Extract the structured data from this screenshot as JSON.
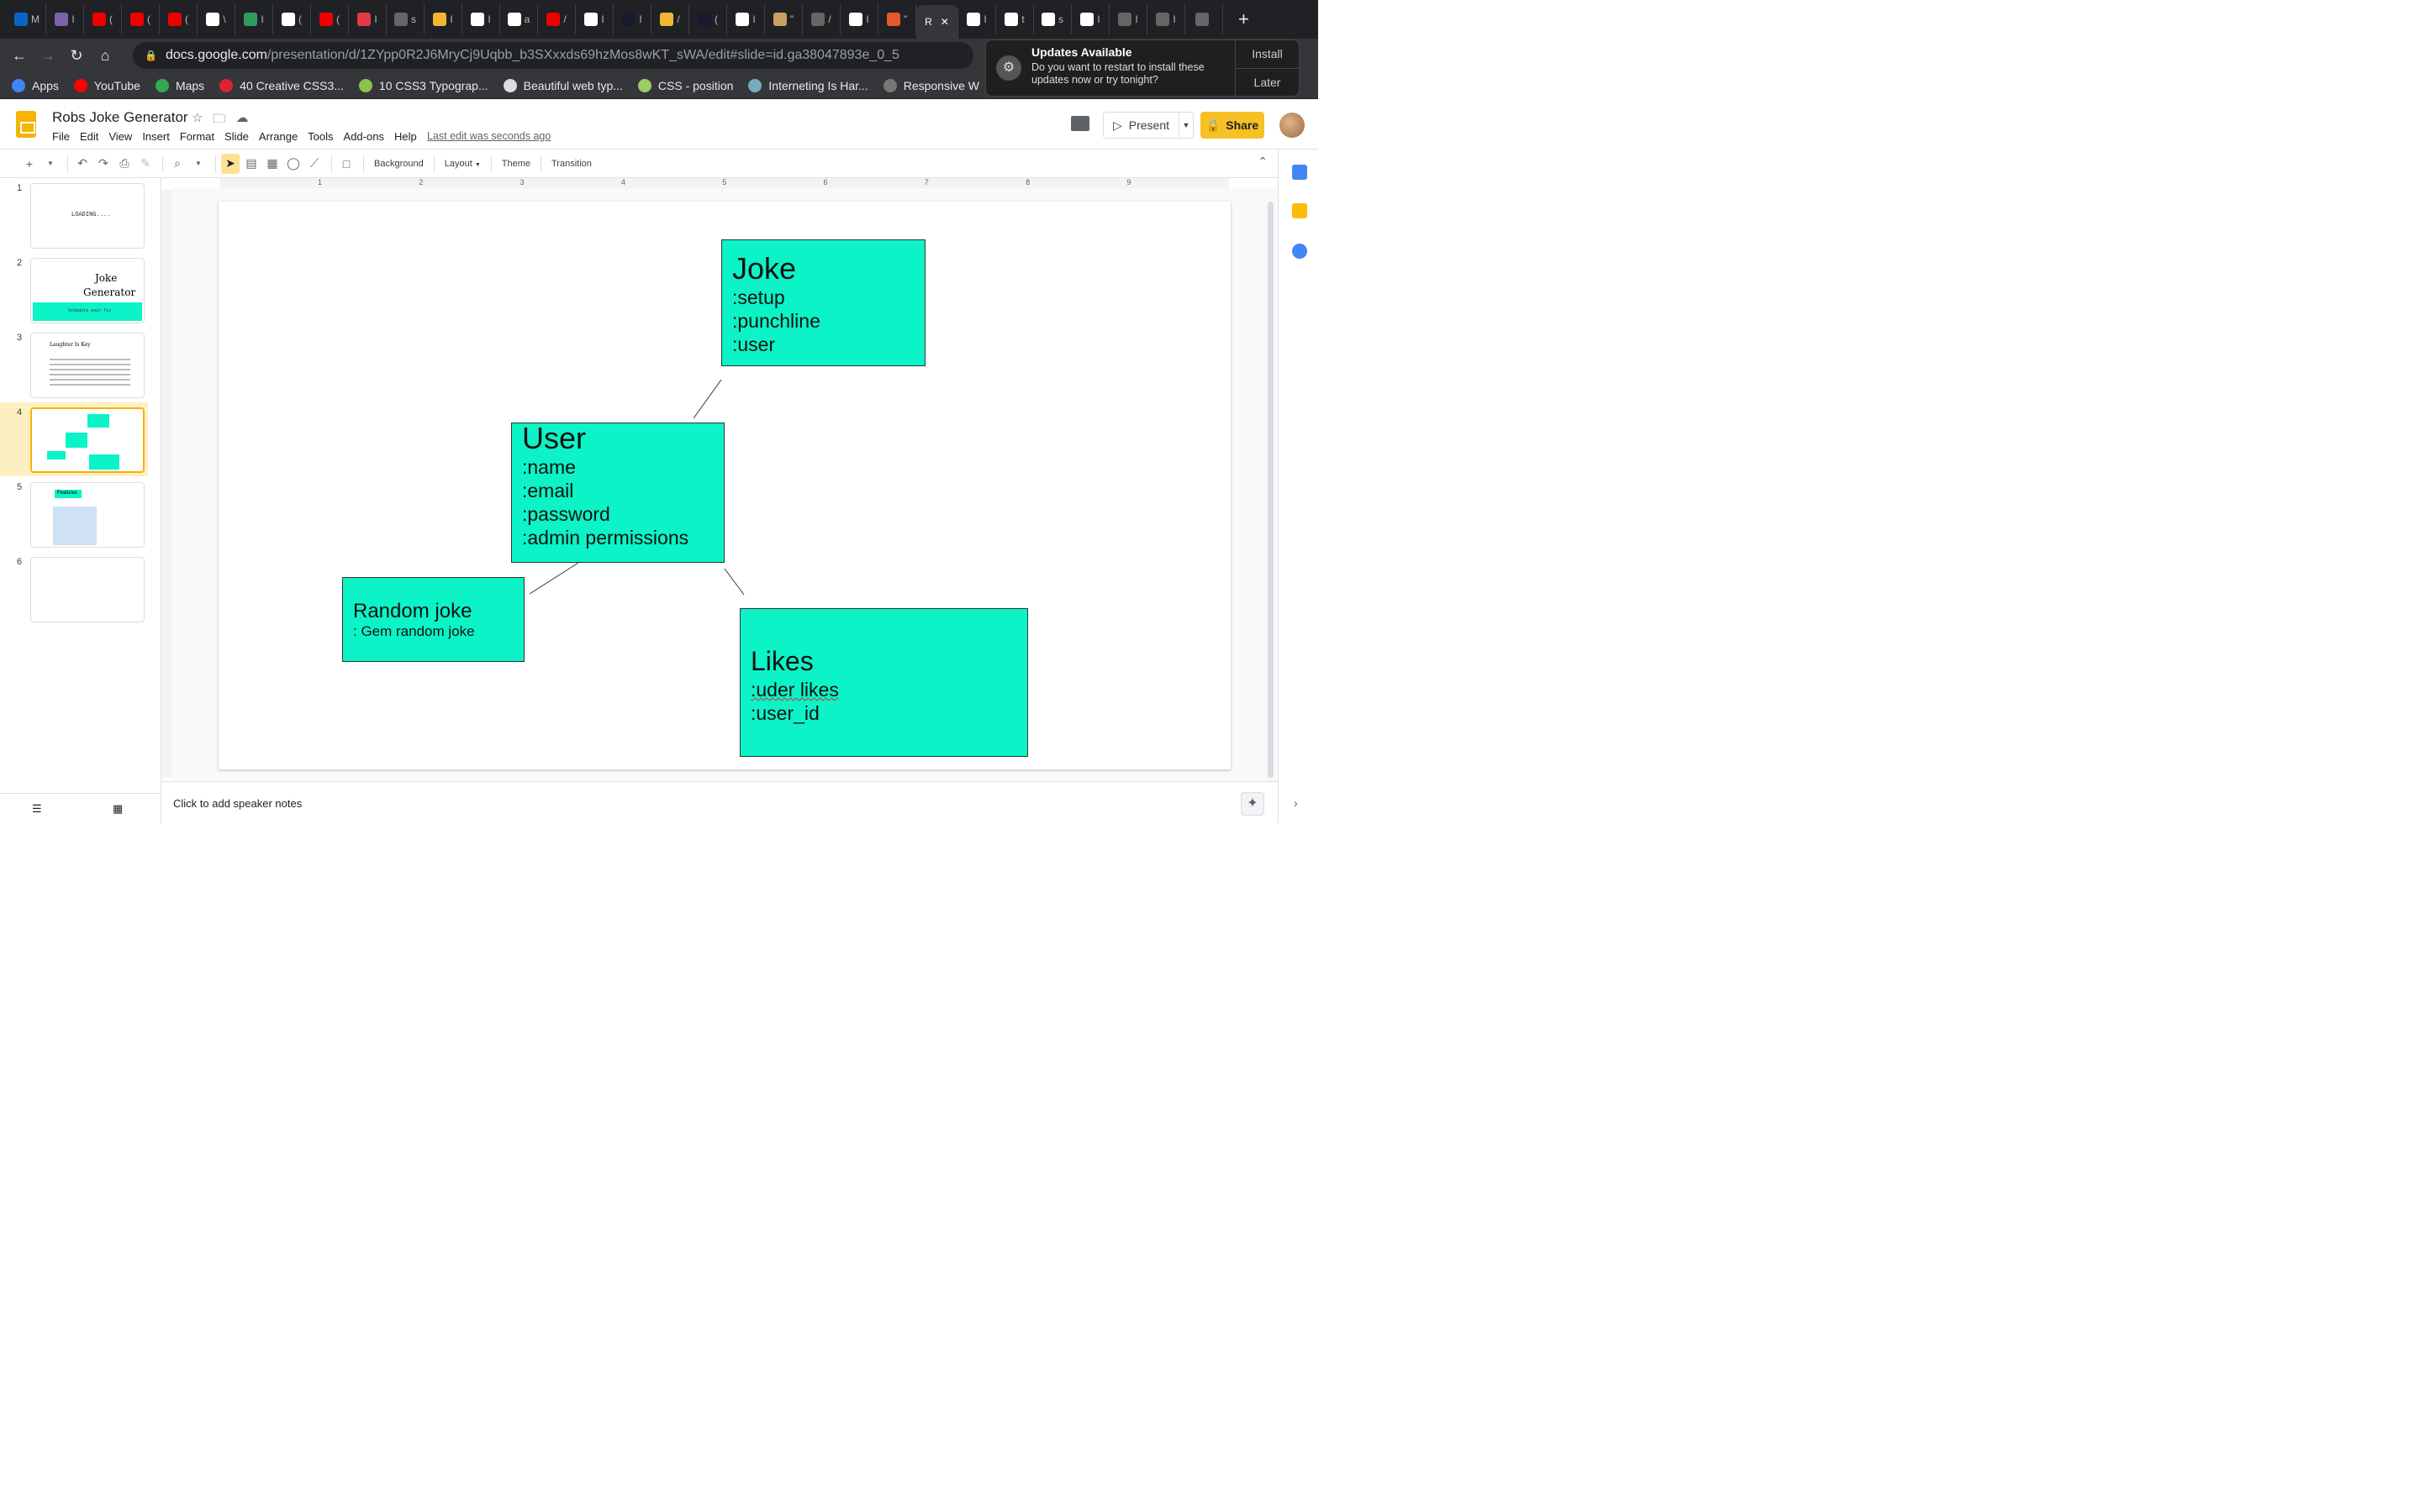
{
  "browser": {
    "tabs": [
      {
        "icon": "outlook-icon",
        "color": "#0a64c8",
        "label": "M"
      },
      {
        "icon": "heroku-icon",
        "color": "#7b61a8",
        "label": "I"
      },
      {
        "icon": "red-hat-icon",
        "color": "#e00",
        "label": "("
      },
      {
        "icon": "red-hat-icon",
        "color": "#e00",
        "label": "("
      },
      {
        "icon": "red-hat-icon",
        "color": "#e00",
        "label": "("
      },
      {
        "icon": "github-icon",
        "color": "#fff",
        "label": "\\"
      },
      {
        "icon": "green-app-icon",
        "color": "#2e9b5d",
        "label": "I"
      },
      {
        "icon": "github-icon",
        "color": "#fff",
        "label": "("
      },
      {
        "icon": "red-logo-icon",
        "color": "#e00",
        "label": "("
      },
      {
        "icon": "m-logo-icon",
        "color": "#e63946",
        "label": "I"
      },
      {
        "icon": "globe-icon",
        "color": "#666",
        "label": "s"
      },
      {
        "icon": "emoji-icon",
        "color": "#f2b632",
        "label": "I"
      },
      {
        "icon": "medium-icon",
        "color": "#fff",
        "label": "I"
      },
      {
        "icon": "github-icon",
        "color": "#fff",
        "label": "a"
      },
      {
        "icon": "red-logo-icon",
        "color": "#e00",
        "label": "/"
      },
      {
        "icon": "google-icon",
        "color": "#fff",
        "label": "I"
      },
      {
        "icon": "code-icon",
        "color": "#1a1a2e",
        "label": "I"
      },
      {
        "icon": "emoji-icon",
        "color": "#f2b632",
        "label": "/"
      },
      {
        "icon": "code-icon",
        "color": "#1a1a2e",
        "label": "("
      },
      {
        "icon": "r-logo-icon",
        "color": "#fff",
        "label": "I"
      },
      {
        "icon": "cat-icon",
        "color": "#c8a060",
        "label": "\""
      },
      {
        "icon": "globe-icon",
        "color": "#666",
        "label": "/"
      },
      {
        "icon": "github-icon",
        "color": "#fff",
        "label": "I"
      },
      {
        "icon": "s-logo-icon",
        "color": "#e8572a",
        "label": "\""
      },
      {
        "icon": "question-icon",
        "color": "#fff",
        "label": "I"
      },
      {
        "icon": "google-icon",
        "color": "#fff",
        "label": "t"
      },
      {
        "icon": "google-icon",
        "color": "#fff",
        "label": "s"
      },
      {
        "icon": "github-icon",
        "color": "#fff",
        "label": "I"
      },
      {
        "icon": "globe-icon",
        "color": "#666",
        "label": "I"
      },
      {
        "icon": "globe-icon",
        "color": "#666",
        "label": "I"
      },
      {
        "icon": "globe-icon",
        "color": "#666",
        "label": ""
      }
    ],
    "active_tab_label": "R",
    "active_tab_index": 24,
    "url_host": "docs.google.com",
    "url_path": "/presentation/d/1ZYpp0R2J6MryCj9Uqbb_b3SXxxds69hzMos8wKT_sWA/edit#slide=id.ga38047893e_0_5",
    "bookmarks": [
      {
        "label": "Apps",
        "color": "#4285f4"
      },
      {
        "label": "YouTube",
        "color": "#ff0000"
      },
      {
        "label": "Maps",
        "color": "#34a853"
      },
      {
        "label": "40 Creative CSS3...",
        "color": "#d23"
      },
      {
        "label": "10 CSS3 Typograp...",
        "color": "#8bc34a"
      },
      {
        "label": "Beautiful web typ...",
        "color": "#ddd"
      },
      {
        "label": "CSS - position",
        "color": "#9ccc65"
      },
      {
        "label": "Interneting Is Har...",
        "color": "#7ab"
      },
      {
        "label": "Responsive W",
        "color": "#777"
      }
    ]
  },
  "notification": {
    "title": "Updates Available",
    "body": "Do you want to restart to install these updates now or try tonight?",
    "install": "Install",
    "later": "Later"
  },
  "app": {
    "title": "Robs Joke Generator",
    "menus": [
      "File",
      "Edit",
      "View",
      "Insert",
      "Format",
      "Slide",
      "Arrange",
      "Tools",
      "Add-ons",
      "Help"
    ],
    "last_edit": "Last edit was seconds ago",
    "present": "Present",
    "share": "Share"
  },
  "toolbar": {
    "background": "Background",
    "layout": "Layout",
    "theme": "Theme",
    "transition": "Transition"
  },
  "ruler_numbers": [
    "1",
    "2",
    "3",
    "4",
    "5",
    "6",
    "7",
    "8",
    "9"
  ],
  "filmstrip": {
    "slides": [
      {
        "num": "1",
        "text": "LOADING...."
      },
      {
        "num": "2",
        "text1": "Joke",
        "text2": "Generator",
        "sub": "Schedule your fix"
      },
      {
        "num": "3",
        "heading": "Laughter Is Key"
      },
      {
        "num": "4"
      },
      {
        "num": "5",
        "heading": "Features"
      },
      {
        "num": "6"
      }
    ],
    "active": 4
  },
  "slide": {
    "joke": {
      "title": "Joke",
      "lines": [
        ":setup",
        ":punchline",
        ":user"
      ]
    },
    "user": {
      "title": "User",
      "lines": [
        ":name",
        ":email",
        ":password",
        ":admin permissions"
      ]
    },
    "random": {
      "title": "Random joke",
      "lines": [
        ": Gem random joke"
      ]
    },
    "likes": {
      "title": "Likes",
      "lines": [
        ":uder likes",
        ":user_id"
      ]
    }
  },
  "notes_placeholder": "Click to add speaker notes",
  "colors": {
    "box": "#0bf3c7",
    "share": "#f6c026",
    "active_slide": "#feefc3"
  }
}
